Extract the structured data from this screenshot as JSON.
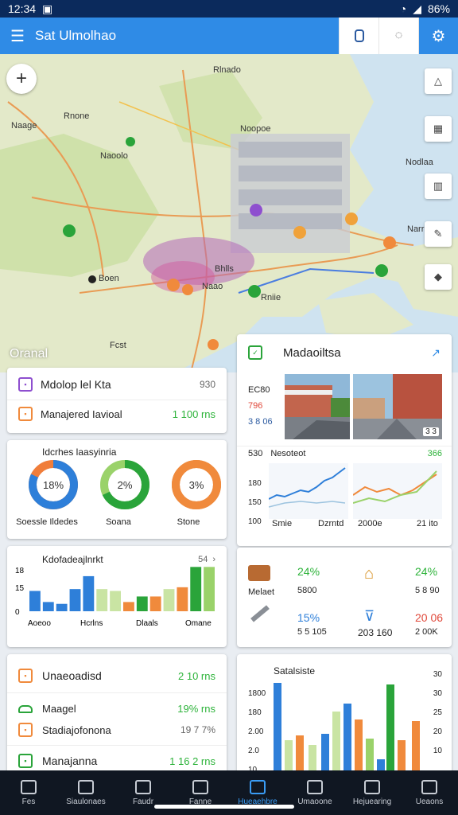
{
  "status": {
    "time": "12:34",
    "battery": "86%"
  },
  "app": {
    "title": "Sat Ulmolhao"
  },
  "map": {
    "labels": [
      "Rlnado",
      "Naage",
      "Rnone",
      "Noopoe",
      "Nodlaa",
      "Naoolo",
      "Naao",
      "Boen",
      "Rniie",
      "Fcst",
      "Bhlls",
      "Narr"
    ],
    "overlay_label": "Oranal"
  },
  "card_summary": {
    "title": "Mdolop lel Kta",
    "value": "930",
    "row_label": "Manajered Iavioal",
    "row_value": "1 100 rns"
  },
  "card_donuts": {
    "title": "Idcrhes laasyinria",
    "items": [
      {
        "label": "Soessle Ildedes",
        "value": "18%",
        "pct": 0.82,
        "color": "#2e7fd9",
        "accent": "#f07d3a"
      },
      {
        "label": "Soana",
        "value": "2%",
        "pct": 0.68,
        "color": "#2aa43a",
        "accent": "#9ad26a"
      },
      {
        "label": "Stone",
        "value": "3%",
        "pct": 1.0,
        "color": "#f08a3c",
        "accent": "#f08a3c"
      }
    ]
  },
  "card_bars": {
    "title": "Kdofadeajlnrkt",
    "value": "54",
    "ylabels": [
      "18",
      "15",
      "0"
    ],
    "xlabels": [
      "Aoeoo",
      "Hcrlns",
      "Dlaals",
      "Omane"
    ]
  },
  "chart_data": {
    "type": "bar",
    "categories": [
      "Aoeoo",
      "Hcrlns",
      "Dlaals",
      "Omane"
    ],
    "values": [
      11,
      5,
      4,
      12,
      19,
      12,
      11,
      5,
      8,
      8,
      12,
      13,
      24,
      24
    ],
    "colors": [
      "#2e7fd9",
      "#2e7fd9",
      "#2e7fd9",
      "#2e7fd9",
      "#2e7fd9",
      "#c9e4a3",
      "#c9e4a3",
      "#f08a3c",
      "#2aa43a",
      "#f08a3c",
      "#c9e4a3",
      "#f08a3c",
      "#2aa43a",
      "#9ad26a"
    ],
    "ylim": [
      0,
      25
    ]
  },
  "card_list": {
    "title": "Unaeoadisd",
    "title_value": "2 10 rns",
    "rows": [
      {
        "label": "Maagel",
        "value": "19% rns"
      },
      {
        "label": "Stadiajofonona",
        "value": "19 7 7%"
      },
      {
        "label": "Manajanna",
        "value": "1 16 2 rns"
      }
    ]
  },
  "panel": {
    "title": "Madaoiltsa",
    "left_values": [
      "EC80",
      "796",
      "3 8 06"
    ],
    "photo_badge": "3 3",
    "line_header_left": "530",
    "line_header_mid": "Nesoteot",
    "line_header_right": "366",
    "line_ylabels": [
      "180",
      "150",
      "100"
    ],
    "line_xlabels": [
      "Smie",
      "Dzrntd",
      "2000e",
      "21 ito"
    ],
    "metrics": [
      {
        "label": "Melaet",
        "value": "24%",
        "sub": "5800",
        "right": "24%",
        "right_sub": "5 8 90",
        "right_color": "#2aa43a"
      },
      {
        "label": "",
        "value": "15%",
        "sub": "5 5 105",
        "right": "20 06",
        "right_sub": "2 00K",
        "right_color": "#e0493b"
      }
    ],
    "metric_mid": "203 160",
    "stats_title": "Satalsiste",
    "stats_ylabels": [
      "1800",
      "180",
      "2.00",
      "2.0",
      "10"
    ],
    "stats_ylabels_right": [
      "30",
      "30",
      "25",
      "20",
      "10"
    ]
  },
  "nav": {
    "items": [
      {
        "label": "Fes",
        "active": false
      },
      {
        "label": "Siaulonaes",
        "active": false
      },
      {
        "label": "Faudr",
        "active": false
      },
      {
        "label": "Fanne",
        "active": false
      },
      {
        "label": "Hueaehbre",
        "active": true
      },
      {
        "label": "Umaoone",
        "active": false
      },
      {
        "label": "Hejuearing",
        "active": false
      },
      {
        "label": "Ueaons",
        "active": false
      }
    ]
  }
}
